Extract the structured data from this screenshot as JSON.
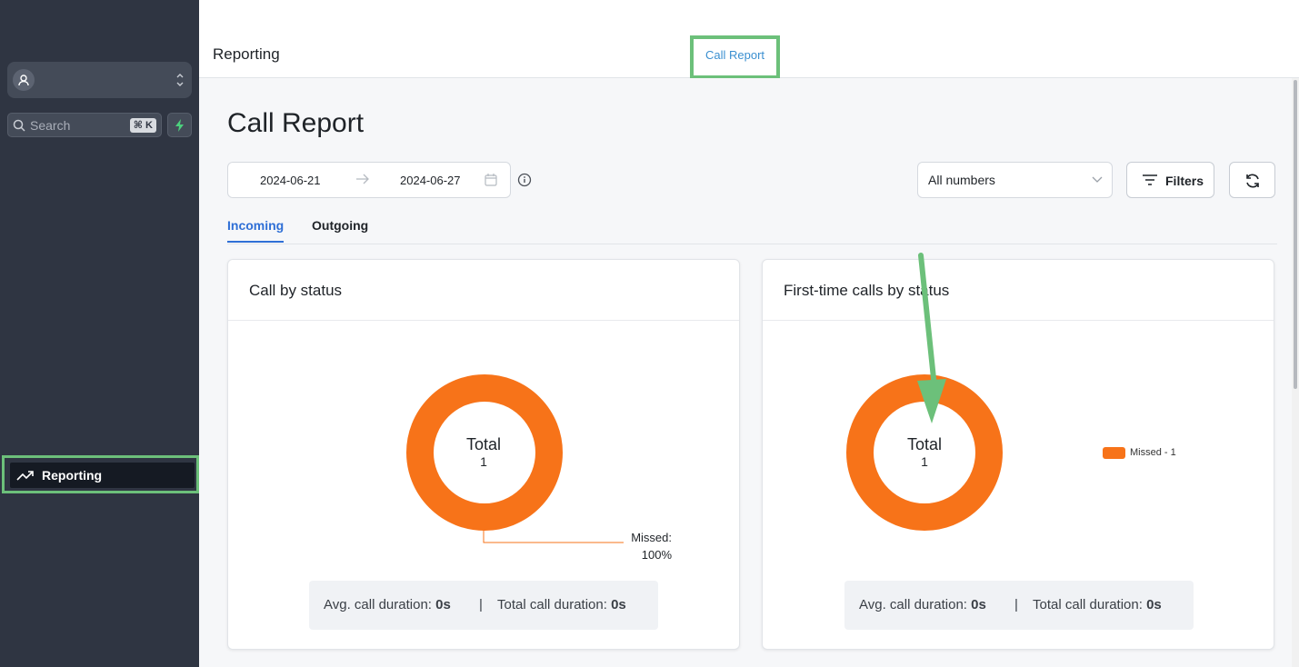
{
  "sidebar": {
    "search_placeholder": "Search",
    "search_shortcut": "⌘ K",
    "nav_reporting": "Reporting"
  },
  "topbar": {
    "title": "Reporting",
    "tab_call_report": "Call Report"
  },
  "main": {
    "page_title": "Call Report",
    "date_start": "2024-06-21",
    "date_end": "2024-06-27",
    "numbers_select": "All numbers",
    "filters_label": "Filters",
    "tabs": [
      "Incoming",
      "Outgoing"
    ],
    "cards": [
      {
        "title": "Call by status",
        "total_label": "Total",
        "total_value": "1",
        "missed_label": "Missed:",
        "missed_pct": "100%",
        "avg_label": "Avg. call duration:",
        "avg_value": "0s",
        "separator": "|",
        "total_dur_label": "Total call duration:",
        "total_dur_value": "0s"
      },
      {
        "title": "First-time calls by status",
        "total_label": "Total",
        "total_value": "1",
        "legend": "Missed - 1",
        "avg_label": "Avg. call duration:",
        "avg_value": "0s",
        "separator": "|",
        "total_dur_label": "Total call duration:",
        "total_dur_value": "0s"
      }
    ]
  },
  "colors": {
    "sidebar_bg": "#2f3542",
    "missed": "#f77319",
    "accent_blue": "#2f6fd6",
    "highlight_green": "#6cc07a"
  },
  "chart_data": [
    {
      "type": "pie",
      "categories": [
        "Missed"
      ],
      "values": [
        1
      ],
      "title": "Call by status"
    },
    {
      "type": "pie",
      "categories": [
        "Missed"
      ],
      "values": [
        1
      ],
      "title": "First-time calls by status"
    }
  ]
}
